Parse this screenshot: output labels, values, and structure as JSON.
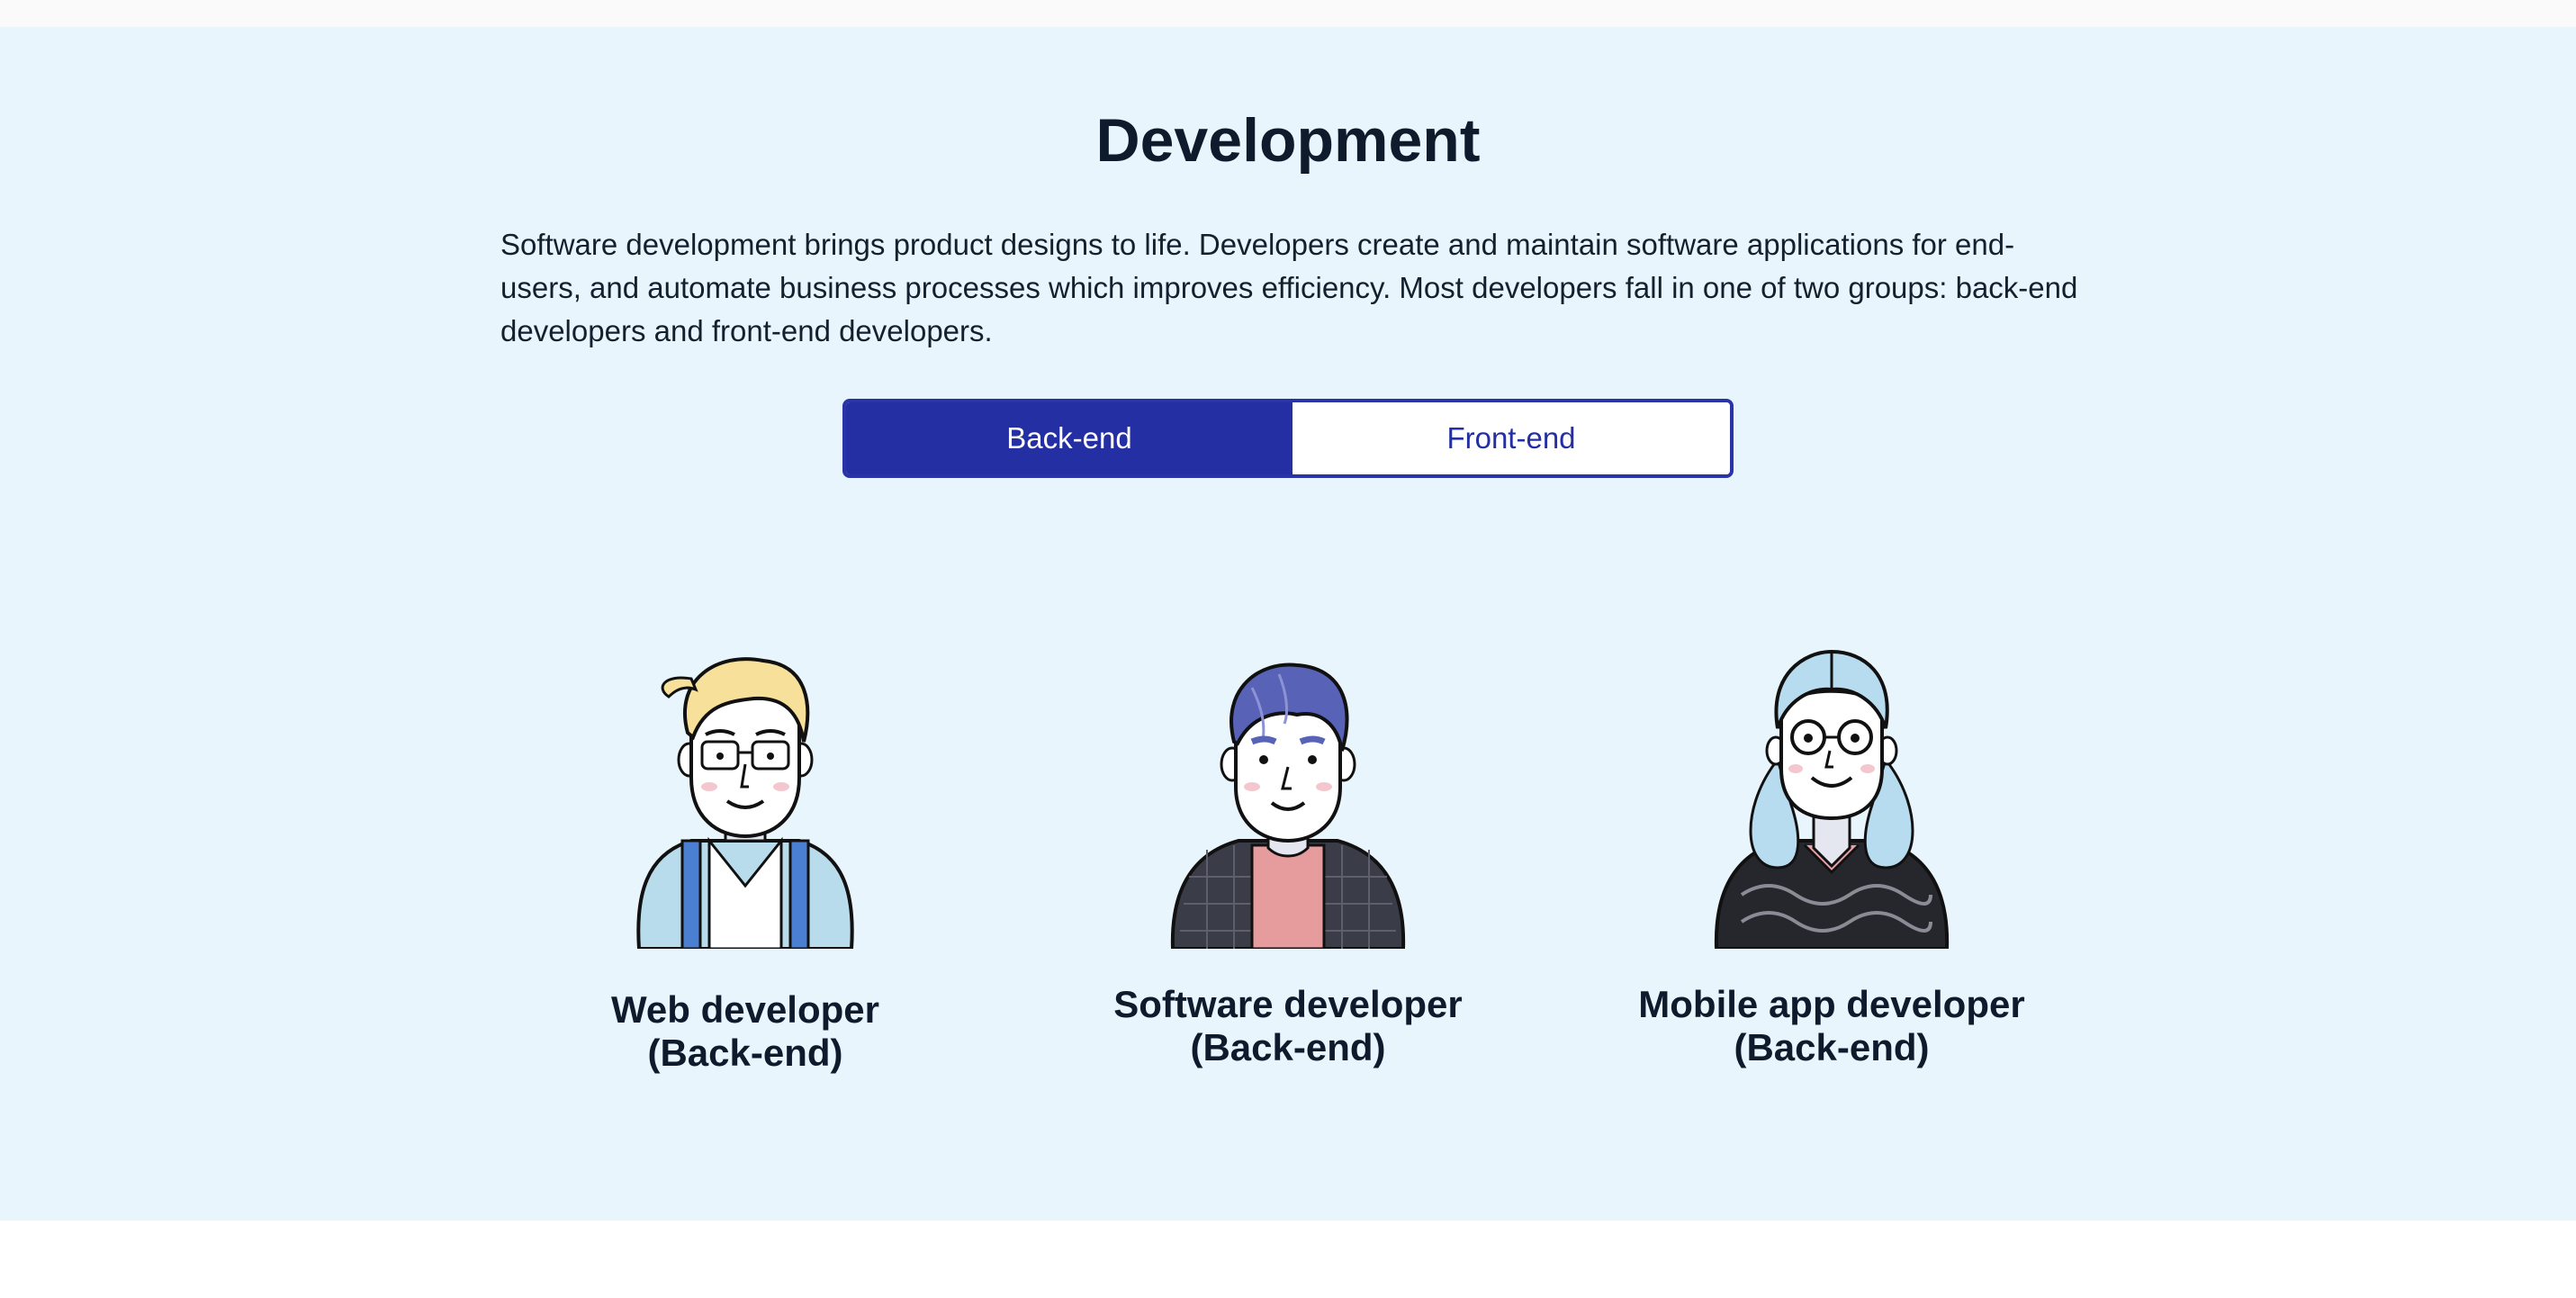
{
  "section": {
    "title": "Development",
    "description": "Software development brings product designs to life. Developers create and maintain software applications for end-users, and automate business processes which improves efficiency. Most developers fall in one of two groups: back-end developers and front-end developers."
  },
  "toggle": {
    "options": [
      {
        "label": "Back-end",
        "selected": true
      },
      {
        "label": "Front-end",
        "selected": false
      }
    ]
  },
  "cards": [
    {
      "line1": "Web developer",
      "line2": "(Back-end)",
      "avatar": "web-developer-avatar"
    },
    {
      "line1": "Software developer",
      "line2": "(Back-end)",
      "avatar": "software-developer-avatar"
    },
    {
      "line1": "Mobile app developer",
      "line2": "(Back-end)",
      "avatar": "mobile-developer-avatar"
    }
  ],
  "colors": {
    "section_bg": "#e9f5fc",
    "accent": "#232fa3",
    "heading": "#0e1b2c"
  }
}
